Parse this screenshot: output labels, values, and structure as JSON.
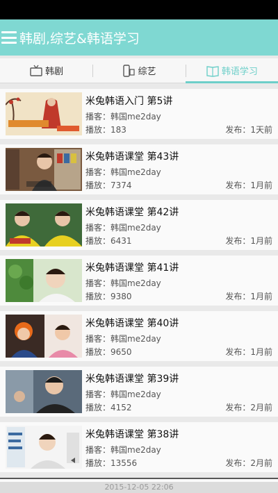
{
  "app_bar": {
    "title": "韩剧,综艺&韩语学习"
  },
  "tabs": [
    {
      "label": "韩剧",
      "icon": "tv-icon",
      "active": false
    },
    {
      "label": "综艺",
      "icon": "phone-icon",
      "active": false
    },
    {
      "label": "韩语学习",
      "icon": "book-icon",
      "active": true
    }
  ],
  "colors": {
    "accent": "#7fd8d2",
    "active_tab": "#6dcfc9"
  },
  "items": [
    {
      "title": "米兔韩语入门 第5讲",
      "uploader": "播客：韩国me2day",
      "plays": "播放：183",
      "published": "发布：1天前"
    },
    {
      "title": "米兔韩语课堂 第43讲",
      "uploader": "播客：韩国me2day",
      "plays": "播放：7374",
      "published": "发布：1月前"
    },
    {
      "title": "米兔韩语课堂 第42讲",
      "uploader": "播客：韩国me2day",
      "plays": "播放：6431",
      "published": "发布：1月前"
    },
    {
      "title": "米兔韩语课堂 第41讲",
      "uploader": "播客：韩国me2day",
      "plays": "播放：9380",
      "published": "发布：1月前"
    },
    {
      "title": "米兔韩语课堂 第40讲",
      "uploader": "播客：韩国me2day",
      "plays": "播放：9650",
      "published": "发布：1月前"
    },
    {
      "title": "米兔韩语课堂 第39讲",
      "uploader": "播客：韩国me2day",
      "plays": "播放：4152",
      "published": "发布：2月前"
    },
    {
      "title": "米兔韩语课堂 第38讲",
      "uploader": "播客：韩国me2day",
      "plays": "播放：13556",
      "published": "发布：2月前"
    }
  ],
  "footer": {
    "timestamp": "2015-12-05 22:06"
  }
}
